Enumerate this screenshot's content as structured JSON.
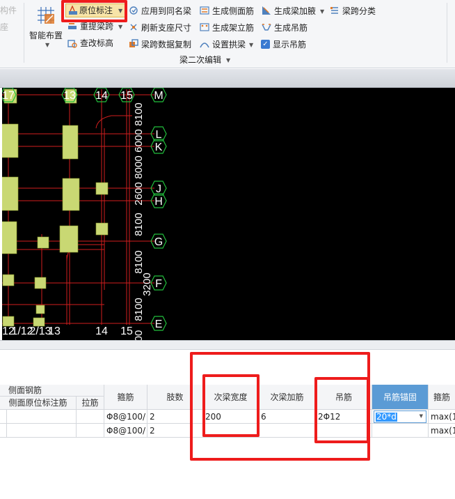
{
  "ribbon": {
    "left_partial_top": "构件",
    "left_partial_mid": "座",
    "smart_layout": "智能布置",
    "in_situ_annotation": "原位标注",
    "reextract_span": "重提梁跨",
    "query_elevation": "查改标高",
    "apply_same_beam": "应用到同名梁",
    "refresh_support": "刷新支座尺寸",
    "span_data_copy": "梁跨数据复制",
    "gen_side_rebar": "生成侧面筋",
    "gen_erection_rebar": "生成架立筋",
    "set_arch_beam": "设置拱梁",
    "gen_haunch": "生成梁加腋",
    "gen_hanger": "生成吊筋",
    "show_hanger": "显示吊筋",
    "span_classify": "梁跨分类",
    "group_label": "梁二次编辑"
  },
  "cad": {
    "axis_top": [
      "17",
      "13",
      "14",
      "15"
    ],
    "axis_bottom": [
      "12",
      "1/12",
      "2/13",
      "13",
      "14",
      "15"
    ],
    "axis_right": [
      "M",
      "L",
      "K",
      "J",
      "H",
      "G",
      "F",
      "E"
    ],
    "vertical_dims": [
      "8100",
      "6000",
      "8000",
      "2600",
      "8100",
      "8100",
      "3200",
      "8100",
      "00"
    ]
  },
  "grid": {
    "group_header": "侧面钢筋",
    "columns": {
      "side_in_situ": "侧面原位标注筋",
      "tie_bar": "拉筋",
      "stirrup": "箍筋",
      "legs": "肢数",
      "secondary_width": "次梁宽度",
      "secondary_add_rebar": "次梁加筋",
      "hanger": "吊筋",
      "hanger_anchor": "吊筋锚固",
      "stirrup2": "箍筋"
    },
    "rows": [
      {
        "stirrup": "Φ8@100/",
        "legs": "2",
        "secondary_width": "200",
        "secondary_add_rebar": "6",
        "hanger": "2Φ12",
        "hanger_anchor": "20*d",
        "stirrup2": "max(1"
      },
      {
        "stirrup": "Φ8@100/",
        "legs": "2",
        "secondary_width": "",
        "secondary_add_rebar": "",
        "hanger": "",
        "hanger_anchor": "",
        "stirrup2": "max(1"
      }
    ]
  },
  "colors": {
    "highlight_red": "#ee1c1c",
    "cad_background": "#000000",
    "cad_grid_red": "#d21e1e",
    "axis_green": "#22c03c",
    "column_fill": "#c9d873",
    "selected_header": "#5b9bd5"
  }
}
